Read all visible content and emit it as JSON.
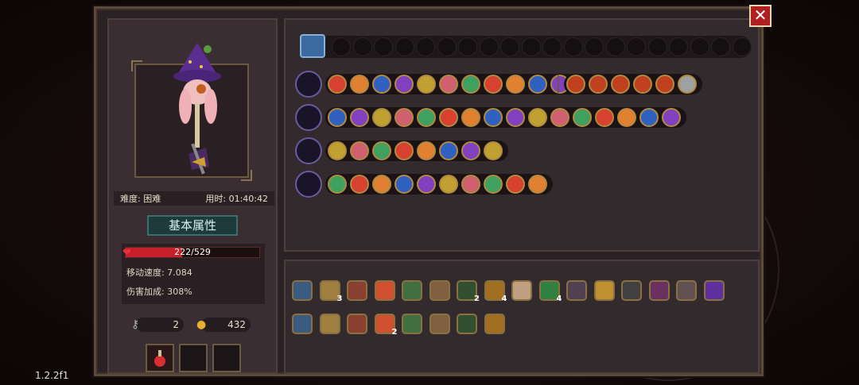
{
  "close_label": "✕",
  "version": "1.2.2f1",
  "character": {
    "difficulty": "难度: 困难",
    "time": "用时: 01:40:42",
    "attr_title": "基本属性",
    "hp_text": "222/529",
    "hp_fraction": 0.42,
    "move_speed": "移动速度: 7.084",
    "damage_bonus": "伤害加成: 308%",
    "keys": "2",
    "coins": "432"
  },
  "colors": {
    "hp": "#c8202a",
    "gold_border": "#b08a40",
    "teal_title": "#3d6e6e"
  },
  "item_counts": [
    "3",
    "2",
    "4",
    "4",
    "2"
  ]
}
